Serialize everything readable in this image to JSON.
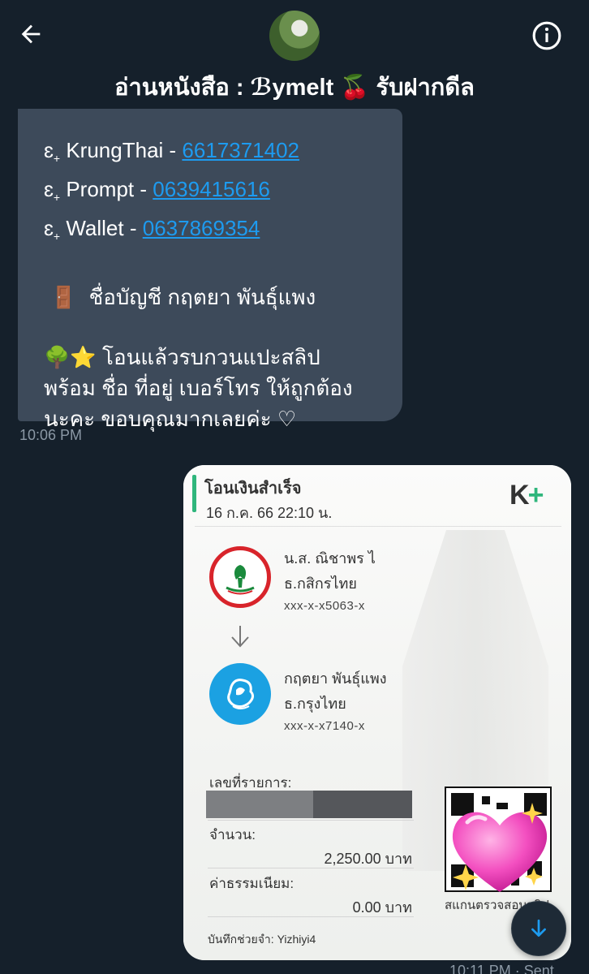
{
  "header": {
    "title_prefix": "อ่านหนังสือ : ",
    "title_name": "ℬymelt",
    "title_emoji": "🍒",
    "title_suffix": " รับฝากดีล"
  },
  "incoming_message": {
    "lines": [
      {
        "bullet": "ɛ",
        "label": " KrungThai - ",
        "number": "6617371402"
      },
      {
        "bullet": "ɛ",
        "label": "Prompt - ",
        "number": "0639415616"
      },
      {
        "bullet": "ɛ",
        "label": "Wallet - ",
        "number": "0637869354"
      }
    ],
    "account_icon": "🚪",
    "account_line": "ชื่อบัญชี กฤตยา พันธุ์แพง",
    "note_emoji": "🌳⭐",
    "note_line1": "โอนแล้วรบกวนแปะสลิป",
    "note_line2": "พร้อม ชื่อ ที่อยู่ เบอร์โทร ให้ถูกต้อง",
    "note_line3": "นะคะ ขอบคุณมากเลยค่ะ ♡",
    "time": "10:06 PM"
  },
  "receipt": {
    "title": "โอนเงินสำเร็จ",
    "date": "16 ก.ค. 66  22:10 น.",
    "brand": "K",
    "brand_plus": "+",
    "sender_name": "น.ส. ณิชาพร ไ",
    "sender_bank": "ธ.กสิกรไทย",
    "sender_account": "xxx-x-x5063-x",
    "receiver_name": "กฤตยา พันธุ์แพง",
    "receiver_bank": "ธ.กรุงไทย",
    "receiver_account": "xxx-x-x7140-x",
    "ref_label": "เลขที่รายการ:",
    "amount_label": "จำนวน:",
    "amount_value": "2,250.00 บาท",
    "fee_label": "ค่าธรรมเนียม:",
    "fee_value": "0.00 บาท",
    "qr_caption": "สแกนตรวจสอบสลิป",
    "memo": "บันทึกช่วยจำ: Yizhiyi4"
  },
  "outgoing_message": {
    "time": "10:11 PM · Sent"
  },
  "colors": {
    "background": "#15202b",
    "bubble_in": "#3d4a5a",
    "link": "#1d9bf0",
    "kplus_green": "#2fb67c",
    "kbank_red": "#d8242b",
    "ktb_blue": "#1ba1e2"
  },
  "icons": {
    "back": "back-arrow-icon",
    "info": "info-icon",
    "scroll_down": "arrow-down-icon"
  }
}
